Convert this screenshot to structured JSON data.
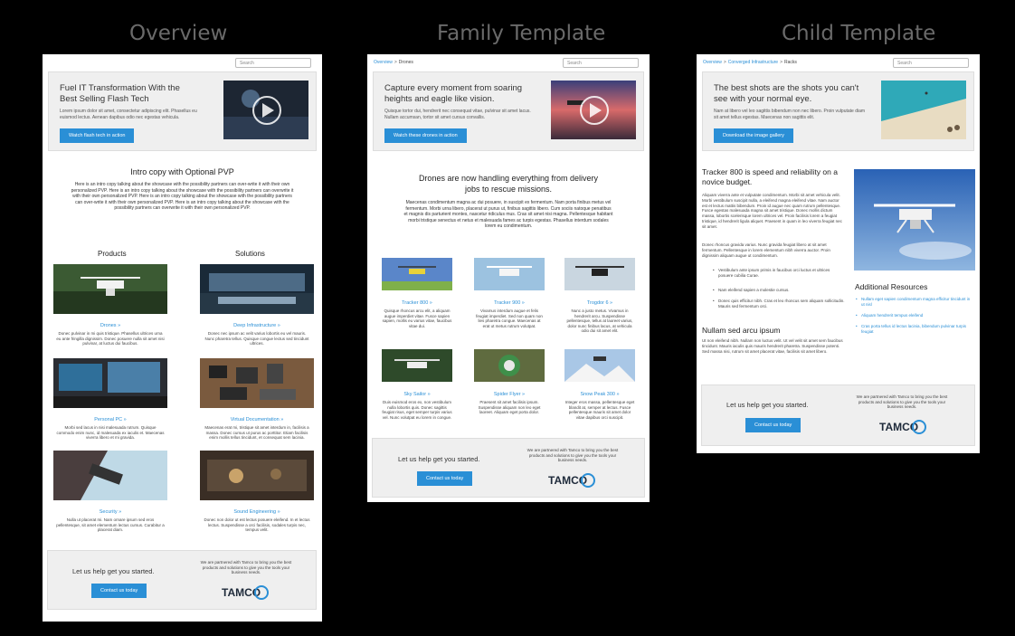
{
  "headings": {
    "overview": "Overview",
    "family": "Family Template",
    "child": "Child Template"
  },
  "search_placeholder": "Search",
  "overview": {
    "hero": {
      "title": "Fuel IT Transformation With the Best Selling Flash Tech",
      "body": "Lorem ipsum dolor sit amet, consectetur adipiscing elit. Phasellus eu euismod lectus. Aenean dapibus odio nec egestas vehicula.",
      "button": "Watch flash tech in action"
    },
    "intro": {
      "title": "Intro copy with Optional PVP",
      "body": "Here is an intro copy talking about the showcase with the possibility partners can over-write it with their own personalized PVP. Here is an intro copy talking about the showcase with the possibility partners can overwrite it with their own personalized PVP. Here is an intro copy talking about the showcase with the possibility partners can over-write it with their own personalized PVP. Here is an intro copy talking about the showcase with the possibility partners can overwrite it with their own personalized PVP."
    },
    "products_heading": "Products",
    "solutions_heading": "Solutions",
    "tiles": [
      {
        "label": "Drones »",
        "desc": "Donec pulvinar in mi quis tristique. Phasellus ultrices urna eu ante fringilla dignissim. Donec posuere nulla sit amet nisi pulvinar, at luctus dui faucibus."
      },
      {
        "label": "Deep Infrastructure »",
        "desc": "Donec nec ipsum ac velit varius lobortis eu vel mauris. Nunc pharetra tellus. Quisque congue lectus sed tincidunt ultrices."
      },
      {
        "label": "Personal PC »",
        "desc": "Morbi sed lacus in nisi malesuada rutrum. Quisque commodo enim nunc, id malesuada ex iaculis et. Maecenas viverra libero et mi gravida."
      },
      {
        "label": "Virtual Documentation »",
        "desc": "Maecenas erat mi, tristique sit amet interdum in, facilisis a massa. Donec cursus ut purus ac porttitor. Etiam facilisis enim mollis tellus tincidunt, et consequat sem lacinia."
      },
      {
        "label": "Security »",
        "desc": "Nulla ut placerat mi. Nam ornare ipsum sed eros pellentesque, sit amet elementum lectus cursus. Curabitur a placerat diam."
      },
      {
        "label": "Sound Engineering »",
        "desc": "Donec non dolor ut est lectus posuere eleifend. In et lectus lectus. Suspendisse a orci facilisis, sodales turpis nec, tempus velit."
      }
    ]
  },
  "family": {
    "crumb": {
      "root": "Overview",
      "sep": ">",
      "current": "Drones"
    },
    "hero": {
      "title": "Capture every moment from soaring heights and eagle like vision.",
      "body": "Quisque tortor dui, hendrerit nec consequat vitae, pulvinar sit amet lacus. Nullam accumsan, tortor sit amet cursus convallis.",
      "button": "Watch these drones in action"
    },
    "intro": {
      "title": "Drones are now handling everything from delivery jobs to rescue missions.",
      "body": "Maecenas condimentum magna ac dui posuere, in suscipit ex fermentum. Nam porta finibus metus vel fermentum. Morbi urna libero, placerat ut purus ut, finibus sagittis libero. Cum sociis natoque penatibus et magnis dis parturient montes, nascetur ridiculus mus. Cras sit amet nisi magna. Pellentesque habitant morbi tristique senectus et netus et malesuada fames ac turpis egestas. Phasellus interdum sodales lorem eu condimentum."
    },
    "tiles": [
      {
        "label": "Tracker 800 »",
        "desc": "Quisque rhoncus arcu elit, a aliquam augue imperdiet vitae. Fusce sapien sapien, mollis eu varius vitae, faucibus vitae dui."
      },
      {
        "label": "Tracker 900 »",
        "desc": "Vivamus interdum augue et felis feugiat imperdiet. Sed non quam non lies pharetra congue. Maecenas at erat ut metus rutrum volutpat."
      },
      {
        "label": "Trogdor 6 »",
        "desc": "Nunc a justo metus. Vivamus in hendrerit arcu. Suspendisse pellentesque, tellus at laoreet varius, dolor nunc finibus lacus, at vehicula odio dui sit amet elit."
      },
      {
        "label": "Sky Sailor »",
        "desc": "Duis euismod eros ex, non vestibulum nulla lobortis quis. Donec sagittis feugiat risus, eget semper turpis varius vel. Nunc volutpat eu lorem in congue."
      },
      {
        "label": "Spider Flyer »",
        "desc": "Praesent sit amet facilisis ipsum. Suspendisse aliquam non leo eget laoreet. Aliquam eget porta dolor."
      },
      {
        "label": "Snow Peak 300 »",
        "desc": "Integer eros massa, pellentesque eget blandit at, semper at lectus. Fusce pellentesque mauris sit amet dolor vitae dapibus orci suscipit."
      }
    ]
  },
  "child": {
    "crumb": {
      "root": "Overview",
      "sep": ">",
      "mid": "Converged Infrastructure",
      "current": "Racks"
    },
    "hero": {
      "title": "The best shots are the shots you can't see with your normal eye.",
      "body": "Nam at libero vel leo sagittis bibendum non nec libero. Proin vulputate diam sit amet tellus egestas. Maecenas non sagittis elit.",
      "button": "Download the image gallery"
    },
    "article": {
      "title": "Tracker 800 is speed and reliability on a novice budget.",
      "p1": "Aliquam viverra ante et vulputate condimentum. Morbi sit amet vehicula velit. Morbi vestibulum suscipit nulla, a eleifend magna eleifend vitae. Nam auctor est et lectus mattis bibendum. Proin id augue nec quam rutrum pellentesque. Fusce egestas malesuada magna sit amet tristique. Donec mollis dictum massa, lobortis scelerisque lorem ultrices vel. Proin facilisis lorem a feugiat tristique, id hendrerit ligula aliquet. Praesent in quam in leo viverra feugiat nec sit amet.",
      "p2": "Donec rhoncus gravida varius. Nunc gravida feugiat libero at sit amet fermentum. Pellentesque in lorem elementum nibh viverra auctor. Proin dignissim aliquam augue ut condimentum.",
      "bullets": [
        "Vestibulum ante ipsum primis in faucibus orci luctus et ultrices posuere cubilia Curae.",
        "Nam eleifend sapien a molestie cursus.",
        "Donec quis efficitur nibh. Cras et leo rhoncus sem aliquam sollicitudin. Mauris sed fermentum orci."
      ],
      "h2": "Nullam sed arcu ipsum",
      "p3": "Ut non eleifend nibh. Nullam non luctus velit. Ut vel velit sit amet sem faucibus tincidunt. Mauris iaculis quis mauris hendrerit pharetra. Suspendisse potenti. Sed massa nisi, rutrum sit amet placerat vitae, facilisis sit amet libero."
    },
    "resources": {
      "title": "Additional Resources",
      "links": [
        "Nullam eget sapien condimentum magna efficitur tincidunt in ut nisl",
        "Aliquam hendrerit tempus eleifend",
        "Cras porta tellus id lectus lacinia, bibendum pulvinar turpis feugiat"
      ]
    }
  },
  "footer": {
    "cta": "Let us help get you started.",
    "button": "Contact us today",
    "partner": "We are partnered with Tamco to bring you the best products and solutions to give you the tools your business needs.",
    "logo": "TAMCO"
  },
  "colors": {
    "accent": "#2a8fd6",
    "panel": "#efefef"
  }
}
